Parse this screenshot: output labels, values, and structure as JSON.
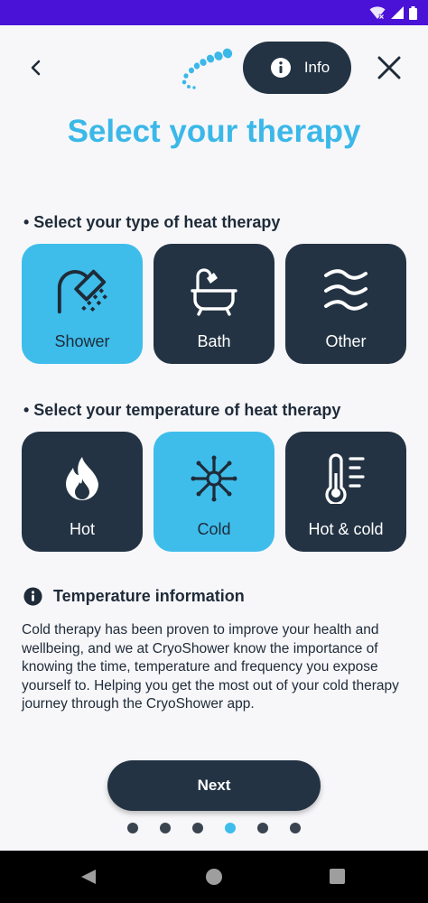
{
  "header": {
    "info_label": "Info",
    "page_title": "Select your therapy"
  },
  "therapy_type": {
    "heading": "• Select your type of heat therapy",
    "options": [
      {
        "label": "Shower",
        "icon": "shower-icon",
        "selected": true
      },
      {
        "label": "Bath",
        "icon": "bathtub-icon",
        "selected": false
      },
      {
        "label": "Other",
        "icon": "waves-icon",
        "selected": false
      }
    ]
  },
  "temperature": {
    "heading": "• Select your temperature of heat therapy",
    "options": [
      {
        "label": "Hot",
        "icon": "flame-icon",
        "selected": false
      },
      {
        "label": "Cold",
        "icon": "snowflake-icon",
        "selected": true
      },
      {
        "label": "Hot & cold",
        "icon": "thermometer-icon",
        "selected": false
      }
    ]
  },
  "temperature_info": {
    "title": "Temperature information",
    "body": "Cold therapy has been proven to improve your health and wellbeing, and we at CryoShower know the importance of knowing the time, temperature and frequency you expose yourself to. Helping you get the most out of your cold therapy journey through the CryoShower app."
  },
  "footer": {
    "next_label": "Next",
    "pager": {
      "total": 6,
      "active_index": 3
    }
  },
  "colors": {
    "accent": "#3EBDEB",
    "dark": "#233343",
    "status_bar": "#4A12D6",
    "background": "#F7F7FA"
  }
}
